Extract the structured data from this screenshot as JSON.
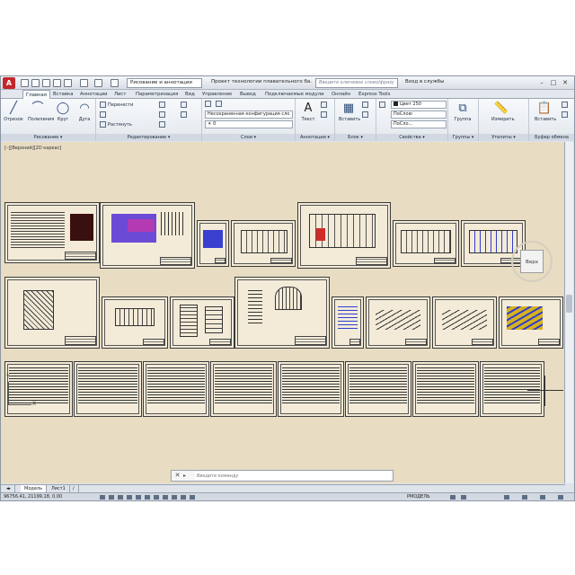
{
  "titlebar": {
    "app_logo": "A",
    "workspace": "Рисование и аннотации",
    "document_title": "Проект технологии плавательного ба...",
    "search_placeholder": "Введите ключевое слово/фразу",
    "signin": "Вход в службы"
  },
  "ribbon_tabs": [
    "Главная",
    "Вставка",
    "Аннотации",
    "Лист",
    "Параметризация",
    "Вид",
    "Управление",
    "Вывод",
    "Подключаемые модули",
    "Онлайн",
    "Express Tools"
  ],
  "panels": {
    "draw": {
      "title": "Рисование ▾",
      "tools": [
        "Отрезок",
        "Полилиния",
        "Круг",
        "Дуга"
      ]
    },
    "modify": {
      "title": "Редактирование ▾",
      "items": [
        "Перенести",
        "Растянуть"
      ]
    },
    "layers": {
      "title": "Слои ▾",
      "config": "Несохраненная конфигурация сло",
      "current": "0"
    },
    "annotation": {
      "title": "Аннотации ▾",
      "tool": "Текст"
    },
    "block": {
      "title": "Блок ▾",
      "tool": "Вставить"
    },
    "properties": {
      "title": "Свойства ▾",
      "color": "Цвет 250",
      "linetype": "ПоСлою",
      "lineweight": "ПоСло..."
    },
    "groups": {
      "title": "Группы ▾",
      "tool": "Группа"
    },
    "utilities": {
      "title": "Утилиты ▾",
      "tool": "Измерить"
    },
    "clipboard": {
      "title": "Буфер обмена",
      "tool": "Вставить"
    }
  },
  "viewport": {
    "label": "[–][Верхний][2D каркас]",
    "viewcube_face": "Верх",
    "ucs_y": "Y",
    "ucs_x": "X",
    "background": "#e8dcc3"
  },
  "command_line": {
    "placeholder": "Введите команду"
  },
  "layout_tabs": [
    "Модель",
    "Лист1",
    "/"
  ],
  "statusbar": {
    "coords": "96756.41, 21199.18, 0.00",
    "model": "РМОДЕЛЬ"
  },
  "colors": {
    "accent_red": "#c3262b",
    "ribbon_blue": "#2b4a7a"
  }
}
